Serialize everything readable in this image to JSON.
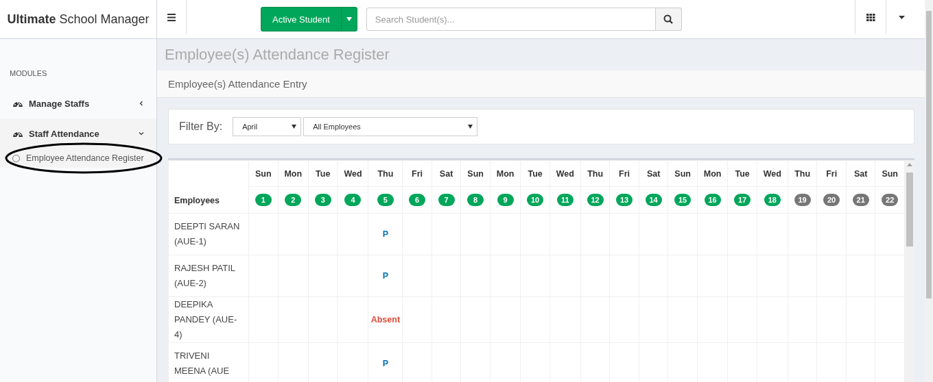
{
  "brand": {
    "bold": "Ultimate",
    "rest": "School Manager"
  },
  "topbar": {
    "student_button": "Active Student",
    "search": {
      "placeholder": "Search Student(s)..."
    }
  },
  "sidebar": {
    "heading": "MODULES",
    "items": [
      {
        "label": "Manage Staffs",
        "expanded": false
      },
      {
        "label": "Staff Attendance",
        "expanded": true,
        "children": [
          {
            "label": "Employee Attendance Register",
            "selected": true
          }
        ]
      }
    ]
  },
  "page": {
    "title": "Employee(s) Attendance Register",
    "subtitle": "Employee(s) Attendance Entry"
  },
  "filter": {
    "label": "Filter By:",
    "month": "April",
    "employees": "All Employees"
  },
  "table": {
    "first_column": "Employees",
    "days": [
      {
        "day": "Sun",
        "date": "1",
        "color": "#00a65a"
      },
      {
        "day": "Mon",
        "date": "2",
        "color": "#00a65a"
      },
      {
        "day": "Tue",
        "date": "3",
        "color": "#00a65a"
      },
      {
        "day": "Wed",
        "date": "4",
        "color": "#00a65a"
      },
      {
        "day": "Thu",
        "date": "5",
        "color": "#00a65a"
      },
      {
        "day": "Fri",
        "date": "6",
        "color": "#00a65a"
      },
      {
        "day": "Sat",
        "date": "7",
        "color": "#00a65a"
      },
      {
        "day": "Sun",
        "date": "8",
        "color": "#00a65a"
      },
      {
        "day": "Mon",
        "date": "9",
        "color": "#00a65a"
      },
      {
        "day": "Tue",
        "date": "10",
        "color": "#00a65a"
      },
      {
        "day": "Wed",
        "date": "11",
        "color": "#00a65a"
      },
      {
        "day": "Thu",
        "date": "12",
        "color": "#00a65a"
      },
      {
        "day": "Fri",
        "date": "13",
        "color": "#00a65a"
      },
      {
        "day": "Sat",
        "date": "14",
        "color": "#00a65a"
      },
      {
        "day": "Sun",
        "date": "15",
        "color": "#00a65a"
      },
      {
        "day": "Mon",
        "date": "16",
        "color": "#00a65a"
      },
      {
        "day": "Tue",
        "date": "17",
        "color": "#00a65a"
      },
      {
        "day": "Wed",
        "date": "18",
        "color": "#00a65a"
      },
      {
        "day": "Thu",
        "date": "19",
        "color": "#777777"
      },
      {
        "day": "Fri",
        "date": "20",
        "color": "#777777"
      },
      {
        "day": "Sat",
        "date": "21",
        "color": "#777777"
      },
      {
        "day": "Sun",
        "date": "22",
        "color": "#777777"
      }
    ],
    "rows": [
      {
        "employee": "DEEPTI SARAN (AUE-1)",
        "cells": [
          {
            "kind": "blank"
          },
          {
            "kind": "blank"
          },
          {
            "kind": "blank"
          },
          {
            "kind": "blank"
          },
          {
            "kind": "present",
            "text": "P"
          },
          {
            "kind": "blank"
          },
          {
            "kind": "blank"
          },
          {
            "kind": "blank"
          },
          {
            "kind": "blank"
          },
          {
            "kind": "blank"
          },
          {
            "kind": "blank"
          },
          {
            "kind": "blank"
          },
          {
            "kind": "blank"
          },
          {
            "kind": "blank"
          },
          {
            "kind": "blank"
          },
          {
            "kind": "blank"
          },
          {
            "kind": "blank"
          },
          {
            "kind": "blank"
          },
          {
            "kind": "blank"
          },
          {
            "kind": "blank"
          },
          {
            "kind": "blank"
          },
          {
            "kind": "blank"
          }
        ]
      },
      {
        "employee": "RAJESH PATIL (AUE-2)",
        "cells": [
          {
            "kind": "blank"
          },
          {
            "kind": "blank"
          },
          {
            "kind": "blank"
          },
          {
            "kind": "blank"
          },
          {
            "kind": "present",
            "text": "P"
          },
          {
            "kind": "blank"
          },
          {
            "kind": "blank"
          },
          {
            "kind": "blank"
          },
          {
            "kind": "blank"
          },
          {
            "kind": "blank"
          },
          {
            "kind": "blank"
          },
          {
            "kind": "blank"
          },
          {
            "kind": "blank"
          },
          {
            "kind": "blank"
          },
          {
            "kind": "blank"
          },
          {
            "kind": "blank"
          },
          {
            "kind": "blank"
          },
          {
            "kind": "blank"
          },
          {
            "kind": "blank"
          },
          {
            "kind": "blank"
          },
          {
            "kind": "blank"
          },
          {
            "kind": "blank"
          }
        ]
      },
      {
        "employee": "DEEPIKA PANDEY (AUE-4)",
        "cells": [
          {
            "kind": "blank"
          },
          {
            "kind": "blank"
          },
          {
            "kind": "blank"
          },
          {
            "kind": "blank"
          },
          {
            "kind": "absent",
            "text": "Absent"
          },
          {
            "kind": "blank"
          },
          {
            "kind": "blank"
          },
          {
            "kind": "blank"
          },
          {
            "kind": "blank"
          },
          {
            "kind": "blank"
          },
          {
            "kind": "blank"
          },
          {
            "kind": "blank"
          },
          {
            "kind": "blank"
          },
          {
            "kind": "blank"
          },
          {
            "kind": "blank"
          },
          {
            "kind": "blank"
          },
          {
            "kind": "blank"
          },
          {
            "kind": "blank"
          },
          {
            "kind": "blank"
          },
          {
            "kind": "blank"
          },
          {
            "kind": "blank"
          },
          {
            "kind": "blank"
          }
        ]
      },
      {
        "employee": "TRIVENI MEENA (AUE",
        "cells": [
          {
            "kind": "blank"
          },
          {
            "kind": "blank"
          },
          {
            "kind": "blank"
          },
          {
            "kind": "blank"
          },
          {
            "kind": "present",
            "text": "P"
          },
          {
            "kind": "blank"
          },
          {
            "kind": "blank"
          },
          {
            "kind": "blank"
          },
          {
            "kind": "blank"
          },
          {
            "kind": "blank"
          },
          {
            "kind": "blank"
          },
          {
            "kind": "blank"
          },
          {
            "kind": "blank"
          },
          {
            "kind": "blank"
          },
          {
            "kind": "blank"
          },
          {
            "kind": "blank"
          },
          {
            "kind": "blank"
          },
          {
            "kind": "blank"
          },
          {
            "kind": "blank"
          },
          {
            "kind": "blank"
          },
          {
            "kind": "blank"
          },
          {
            "kind": "blank"
          }
        ]
      }
    ]
  }
}
